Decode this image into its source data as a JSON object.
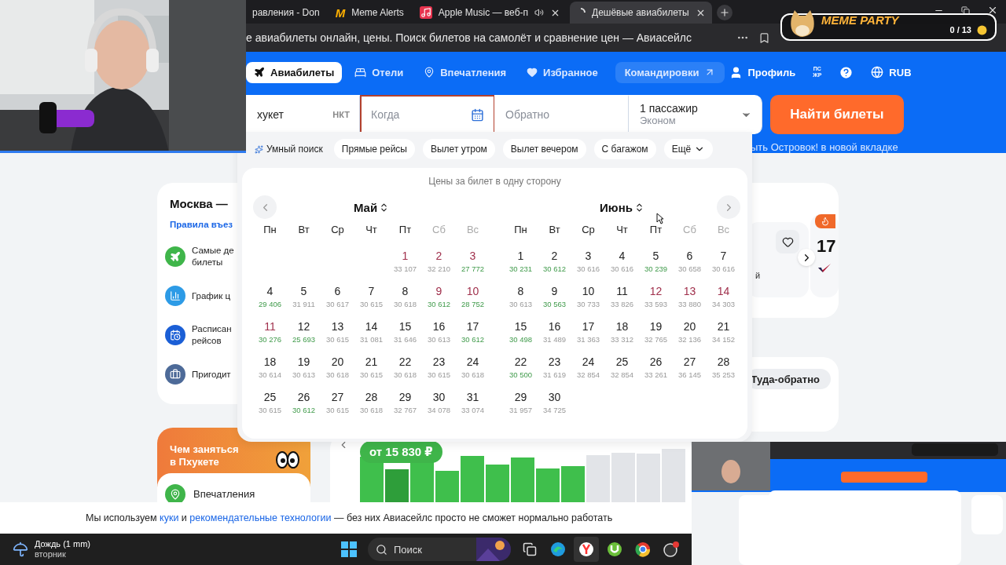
{
  "browser": {
    "tabs": [
      {
        "kind": "plain",
        "label": "равления - Don",
        "selected": false,
        "closable": false
      },
      {
        "kind": "logo",
        "logo": "M",
        "label": "Meme Alerts",
        "selected": false,
        "closable": false
      },
      {
        "kind": "music",
        "label": "Apple Music — веб-п",
        "selected": false,
        "closable": true
      },
      {
        "kind": "loading",
        "label": "Дешёвые авиабилеты",
        "selected": true,
        "closable": true
      }
    ],
    "address": "е авиабилеты онлайн, цены. Поиск билетов на самолёт и сравнение цен — Авиасейлс"
  },
  "overlay_widget": {
    "title": "MEME PARTY",
    "counter": "0 / 13"
  },
  "nav": {
    "items": [
      {
        "label": "Авиабилеты",
        "selected": true
      },
      {
        "label": "Отели",
        "selected": false
      },
      {
        "label": "Впечатления",
        "selected": false
      },
      {
        "label": "Избранное",
        "selected": false
      }
    ],
    "business": "Командировки",
    "profile": "Профиль",
    "vision_mode": "ПС\nЖР",
    "currency": "RUB"
  },
  "search": {
    "origin": {
      "value": "хукет",
      "code": "НКТ"
    },
    "depart": {
      "placeholder": "Когда",
      "active": true
    },
    "return": {
      "placeholder": "Обратно",
      "active": false
    },
    "passengers": {
      "count": "1 пассажир",
      "cabin": "Эконом"
    },
    "submit": "Найти билеты",
    "promo": "ыть Островок! в новой вкладке"
  },
  "filters": [
    {
      "kind": "smart",
      "label": "Умный поиск"
    },
    {
      "kind": "chip",
      "label": "Прямые рейсы"
    },
    {
      "kind": "chip",
      "label": "Вылет утром"
    },
    {
      "kind": "chip",
      "label": "Вылет вечером"
    },
    {
      "kind": "chip",
      "label": "С багажом"
    },
    {
      "kind": "more",
      "label": "Ещё"
    }
  ],
  "calendar": {
    "caption": "Цены за билет в одну сторону",
    "months": [
      {
        "name": "Май",
        "weekdays": [
          {
            "label": "Пн",
            "weekend": false
          },
          {
            "label": "Вт",
            "weekend": false
          },
          {
            "label": "Ср",
            "weekend": false
          },
          {
            "label": "Чт",
            "weekend": false
          },
          {
            "label": "Пт",
            "weekend": false
          },
          {
            "label": "Сб",
            "weekend": true
          },
          {
            "label": "Вс",
            "weekend": true
          }
        ],
        "days": [
          {
            "kind": "empty"
          },
          {
            "kind": "empty"
          },
          {
            "kind": "empty"
          },
          {
            "kind": "empty"
          },
          {
            "kind": "day",
            "day": "1",
            "price": "33 107",
            "holiday": true,
            "cheap": false
          },
          {
            "kind": "day",
            "day": "2",
            "price": "32 210",
            "holiday": true,
            "cheap": false
          },
          {
            "kind": "day",
            "day": "3",
            "price": "27 772",
            "holiday": true,
            "cheap": true
          },
          {
            "kind": "day",
            "day": "4",
            "price": "29 406",
            "holiday": false,
            "cheap": true
          },
          {
            "kind": "day",
            "day": "5",
            "price": "31 911",
            "holiday": false,
            "cheap": false
          },
          {
            "kind": "day",
            "day": "6",
            "price": "30 617",
            "holiday": false,
            "cheap": false
          },
          {
            "kind": "day",
            "day": "7",
            "price": "30 615",
            "holiday": false,
            "cheap": false
          },
          {
            "kind": "day",
            "day": "8",
            "price": "30 618",
            "holiday": false,
            "cheap": false
          },
          {
            "kind": "day",
            "day": "9",
            "price": "30 612",
            "holiday": true,
            "cheap": true
          },
          {
            "kind": "day",
            "day": "10",
            "price": "28 752",
            "holiday": true,
            "cheap": true
          },
          {
            "kind": "day",
            "day": "11",
            "price": "30 276",
            "holiday": true,
            "cheap": true
          },
          {
            "kind": "day",
            "day": "12",
            "price": "25 693",
            "holiday": false,
            "cheap": true
          },
          {
            "kind": "day",
            "day": "13",
            "price": "30 615",
            "holiday": false,
            "cheap": false
          },
          {
            "kind": "day",
            "day": "14",
            "price": "31 081",
            "holiday": false,
            "cheap": false
          },
          {
            "kind": "day",
            "day": "15",
            "price": "31 646",
            "holiday": false,
            "cheap": false
          },
          {
            "kind": "day",
            "day": "16",
            "price": "30 613",
            "holiday": false,
            "cheap": false
          },
          {
            "kind": "day",
            "day": "17",
            "price": "30 612",
            "holiday": false,
            "cheap": true
          },
          {
            "kind": "day",
            "day": "18",
            "price": "30 614",
            "holiday": false,
            "cheap": false
          },
          {
            "kind": "day",
            "day": "19",
            "price": "30 613",
            "holiday": false,
            "cheap": false
          },
          {
            "kind": "day",
            "day": "20",
            "price": "30 618",
            "holiday": false,
            "cheap": false
          },
          {
            "kind": "day",
            "day": "21",
            "price": "30 615",
            "holiday": false,
            "cheap": false
          },
          {
            "kind": "day",
            "day": "22",
            "price": "30 618",
            "holiday": false,
            "cheap": false
          },
          {
            "kind": "day",
            "day": "23",
            "price": "30 615",
            "holiday": false,
            "cheap": false
          },
          {
            "kind": "day",
            "day": "24",
            "price": "30 618",
            "holiday": false,
            "cheap": false
          },
          {
            "kind": "day",
            "day": "25",
            "price": "30 615",
            "holiday": false,
            "cheap": false
          },
          {
            "kind": "day",
            "day": "26",
            "price": "30 612",
            "holiday": false,
            "cheap": true
          },
          {
            "kind": "day",
            "day": "27",
            "price": "30 615",
            "holiday": false,
            "cheap": false
          },
          {
            "kind": "day",
            "day": "28",
            "price": "30 618",
            "holiday": false,
            "cheap": false
          },
          {
            "kind": "day",
            "day": "29",
            "price": "32 767",
            "holiday": false,
            "cheap": false
          },
          {
            "kind": "day",
            "day": "30",
            "price": "34 078",
            "holiday": false,
            "cheap": false
          },
          {
            "kind": "day",
            "day": "31",
            "price": "33 074",
            "holiday": false,
            "cheap": false
          }
        ]
      },
      {
        "name": "Июнь",
        "weekdays": [
          {
            "label": "Пн",
            "weekend": false
          },
          {
            "label": "Вт",
            "weekend": false
          },
          {
            "label": "Ср",
            "weekend": false
          },
          {
            "label": "Чт",
            "weekend": false
          },
          {
            "label": "Пт",
            "weekend": false
          },
          {
            "label": "Сб",
            "weekend": true
          },
          {
            "label": "Вс",
            "weekend": true
          }
        ],
        "days": [
          {
            "kind": "day",
            "day": "1",
            "price": "30 231",
            "holiday": false,
            "cheap": true
          },
          {
            "kind": "day",
            "day": "2",
            "price": "30 612",
            "holiday": false,
            "cheap": true
          },
          {
            "kind": "day",
            "day": "3",
            "price": "30 616",
            "holiday": false,
            "cheap": false
          },
          {
            "kind": "day",
            "day": "4",
            "price": "30 616",
            "holiday": false,
            "cheap": false
          },
          {
            "kind": "day",
            "day": "5",
            "price": "30 239",
            "holiday": false,
            "cheap": true
          },
          {
            "kind": "day",
            "day": "6",
            "price": "30 658",
            "holiday": false,
            "cheap": false
          },
          {
            "kind": "day",
            "day": "7",
            "price": "30 616",
            "holiday": false,
            "cheap": false
          },
          {
            "kind": "day",
            "day": "8",
            "price": "30 613",
            "holiday": false,
            "cheap": false
          },
          {
            "kind": "day",
            "day": "9",
            "price": "30 563",
            "holiday": false,
            "cheap": true
          },
          {
            "kind": "day",
            "day": "10",
            "price": "30 733",
            "holiday": false,
            "cheap": false
          },
          {
            "kind": "day",
            "day": "11",
            "price": "33 826",
            "holiday": false,
            "cheap": false
          },
          {
            "kind": "day",
            "day": "12",
            "price": "33 593",
            "holiday": true,
            "cheap": false
          },
          {
            "kind": "day",
            "day": "13",
            "price": "33 880",
            "holiday": true,
            "cheap": false
          },
          {
            "kind": "day",
            "day": "14",
            "price": "34 303",
            "holiday": true,
            "cheap": false
          },
          {
            "kind": "day",
            "day": "15",
            "price": "30 498",
            "holiday": false,
            "cheap": true
          },
          {
            "kind": "day",
            "day": "16",
            "price": "31 489",
            "holiday": false,
            "cheap": false
          },
          {
            "kind": "day",
            "day": "17",
            "price": "31 363",
            "holiday": false,
            "cheap": false
          },
          {
            "kind": "day",
            "day": "18",
            "price": "33 312",
            "holiday": false,
            "cheap": false
          },
          {
            "kind": "day",
            "day": "19",
            "price": "32 765",
            "holiday": false,
            "cheap": false
          },
          {
            "kind": "day",
            "day": "20",
            "price": "32 136",
            "holiday": false,
            "cheap": false
          },
          {
            "kind": "day",
            "day": "21",
            "price": "34 152",
            "holiday": false,
            "cheap": false
          },
          {
            "kind": "day",
            "day": "22",
            "price": "30 500",
            "holiday": false,
            "cheap": true
          },
          {
            "kind": "day",
            "day": "23",
            "price": "31 619",
            "holiday": false,
            "cheap": false
          },
          {
            "kind": "day",
            "day": "24",
            "price": "32 854",
            "holiday": false,
            "cheap": false
          },
          {
            "kind": "day",
            "day": "25",
            "price": "32 854",
            "holiday": false,
            "cheap": false
          },
          {
            "kind": "day",
            "day": "26",
            "price": "33 261",
            "holiday": false,
            "cheap": false
          },
          {
            "kind": "day",
            "day": "27",
            "price": "36 145",
            "holiday": false,
            "cheap": false
          },
          {
            "kind": "day",
            "day": "28",
            "price": "35 253",
            "holiday": false,
            "cheap": false
          },
          {
            "kind": "day",
            "day": "29",
            "price": "31 957",
            "holiday": false,
            "cheap": false
          },
          {
            "kind": "day",
            "day": "30",
            "price": "34 725",
            "holiday": false,
            "cheap": false
          }
        ]
      }
    ]
  },
  "route_card": {
    "title": "Москва —",
    "rules_link": "Правила въез",
    "links": [
      {
        "label": "Самые де\nбилеты"
      },
      {
        "label": "График ц"
      },
      {
        "label": "Расписан\nрейсов"
      },
      {
        "label": "Пригодит"
      }
    ]
  },
  "activities_card": {
    "title": "Чем заняться\nв Пхукете",
    "link": "Впечатления"
  },
  "deal_card": {
    "text_fragment": "й",
    "price_fragment": "17"
  },
  "trip_card": {
    "trip_type": "Туда-обратно"
  },
  "price_chart": {
    "badge": "от 15 830 ₽"
  },
  "cookie_notice": [
    {
      "kind": "text",
      "text": "Мы используем "
    },
    {
      "kind": "link",
      "text": "куки"
    },
    {
      "kind": "text",
      "text": " и "
    },
    {
      "kind": "link",
      "text": "рекомендательные технологии"
    },
    {
      "kind": "text",
      "text": " — без них Авиасейлс просто не сможет нормально работать"
    }
  ],
  "taskbar": {
    "weather": {
      "title": "Дождь (1 mm)",
      "day": "вторник"
    },
    "search": "Поиск"
  }
}
